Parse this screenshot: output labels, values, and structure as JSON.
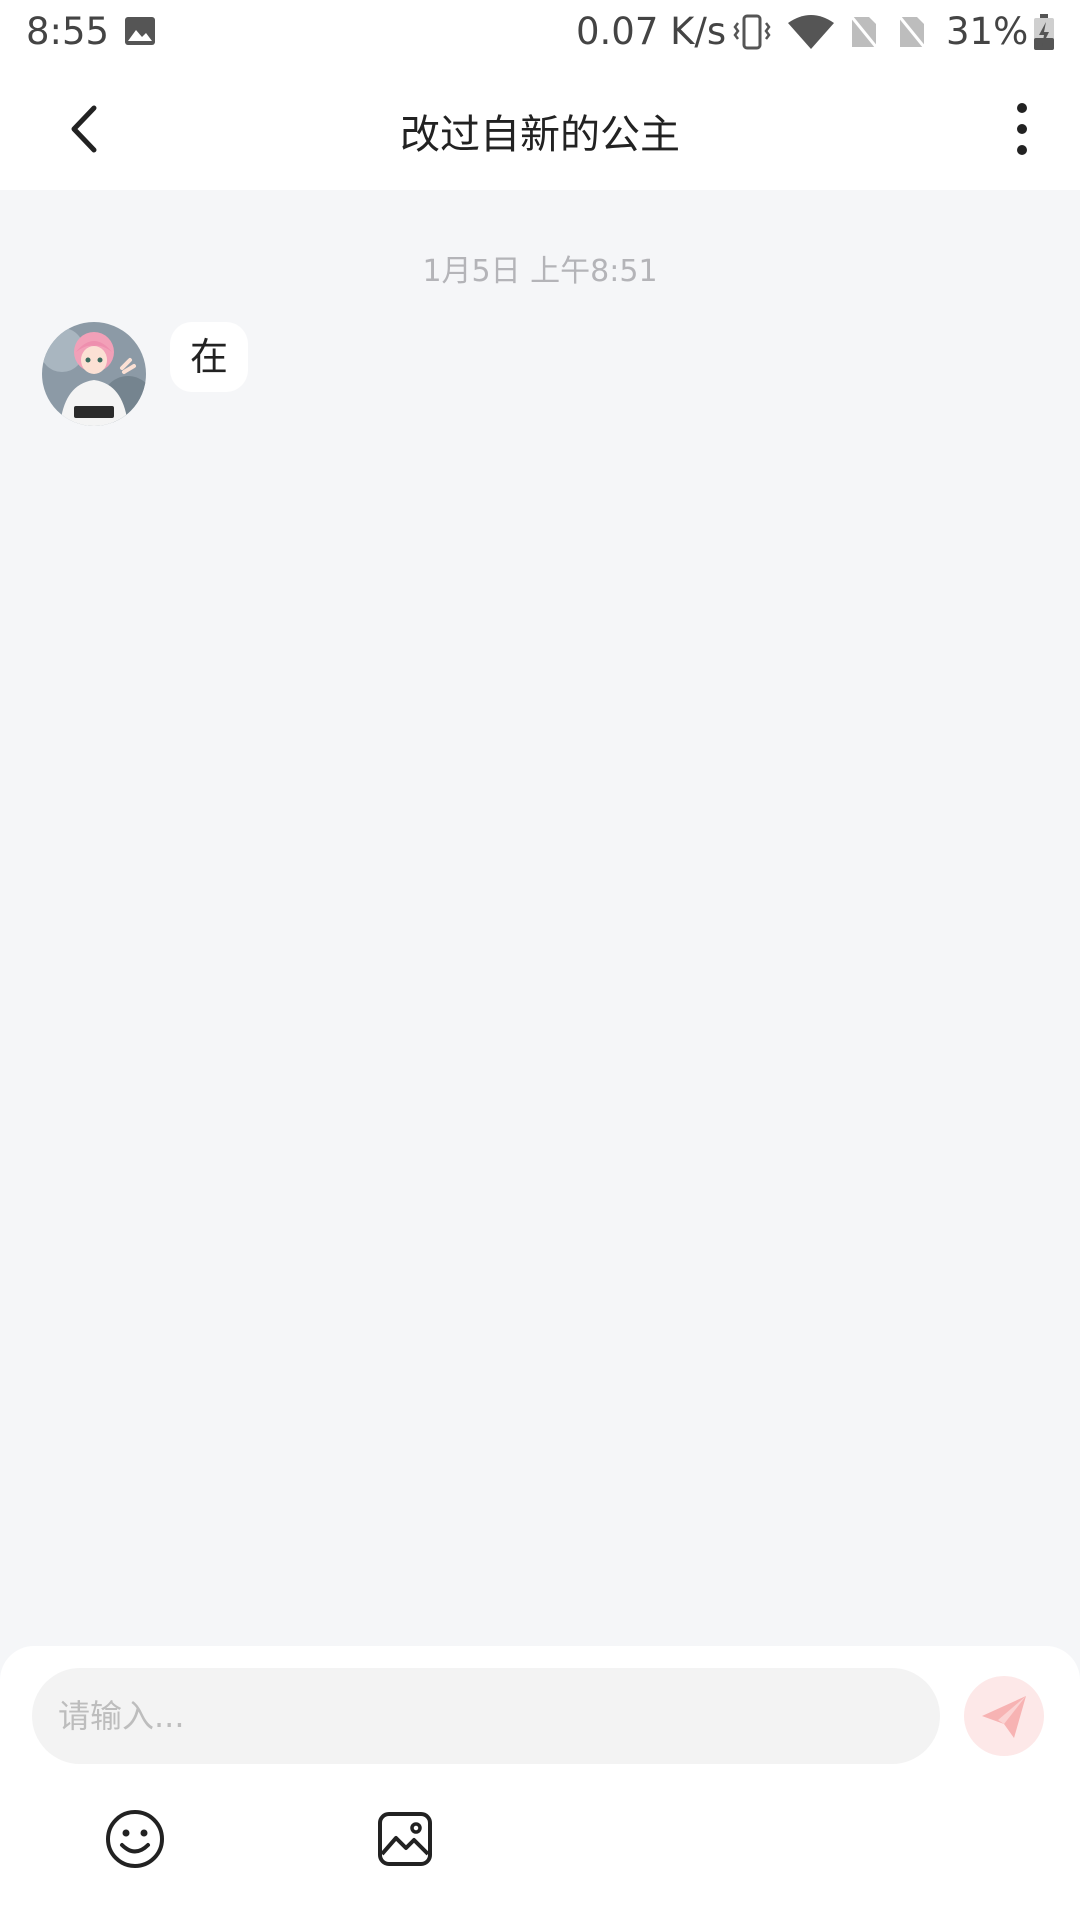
{
  "status_bar": {
    "time": "8:55",
    "network_speed": "0.07 K/s",
    "battery": "31%",
    "icons": [
      "image-icon",
      "vibrate-icon",
      "wifi-icon",
      "no-sim-icon",
      "no-sim-icon",
      "battery-charging-icon"
    ]
  },
  "header": {
    "title": "改过自新的公主",
    "back_icon": "chevron-left-icon",
    "more_icon": "more-vertical-icon"
  },
  "chat": {
    "timestamp": "1月5日 上午8:51",
    "messages": [
      {
        "sender": "other",
        "text": "在"
      }
    ]
  },
  "composer": {
    "placeholder": "请输入...",
    "value": "",
    "send_icon": "send-icon",
    "toolbar_icons": [
      "emoji-icon",
      "image-icon"
    ]
  },
  "colors": {
    "background": "#f5f6f8",
    "send_button_bg": "#fde8e8",
    "send_icon": "#f7b3b3"
  }
}
